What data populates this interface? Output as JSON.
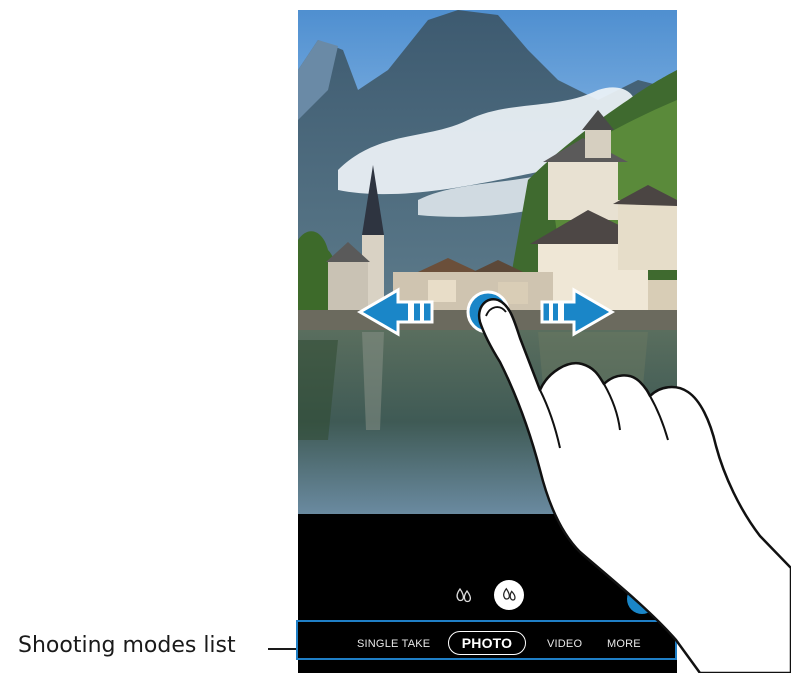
{
  "callout": {
    "label": "Shooting modes list"
  },
  "camera": {
    "modes": [
      {
        "label": "SINGLE TAKE",
        "selected": false
      },
      {
        "label": "PHOTO",
        "selected": true
      },
      {
        "label": "VIDEO",
        "selected": false
      },
      {
        "label": "MORE",
        "selected": false
      }
    ],
    "icons": {
      "effect_off": "lens-effect-icon",
      "effect_on": "lens-effect-active-icon",
      "bixby": "bixby-vision-icon"
    },
    "gesture": {
      "swipe_left": "arrow-left-icon",
      "swipe_right": "arrow-right-icon",
      "finger": "hand-icon"
    },
    "colors": {
      "accent": "#1f7fc6",
      "arrow": "#1a86c8"
    }
  }
}
